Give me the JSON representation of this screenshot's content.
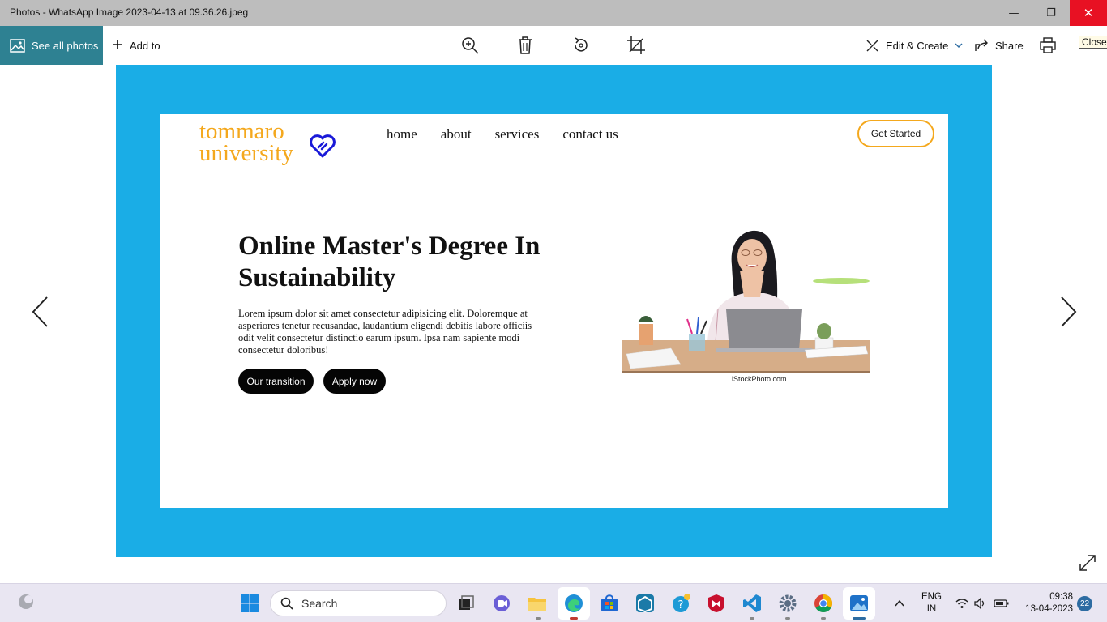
{
  "window": {
    "title": "Photos - WhatsApp Image 2023-04-13 at 09.36.26.jpeg",
    "minimize_glyph": "—",
    "maximize_glyph": "❐",
    "close_glyph": "✕"
  },
  "toolbar": {
    "see_all_photos": "See all photos",
    "add_to": "Add to",
    "edit_create": "Edit & Create",
    "share": "Share",
    "close_tooltip": "Close",
    "icons": [
      "zoom-in-icon",
      "delete-icon",
      "rotate-icon",
      "crop-icon",
      "print-icon"
    ]
  },
  "photo": {
    "background_color": "#1aade6",
    "site": {
      "logo_line1": "tommaro",
      "logo_line2": "university",
      "logo_color": "#f4a81d",
      "nav": [
        "home",
        "about",
        "services",
        "contact us"
      ],
      "cta": "Get Started",
      "headline": "Online Master's Degree In Sustainability",
      "body": "Lorem ipsum dolor sit amet consectetur adipisicing elit. Doloremque at asperiores tenetur recusandae, laudantium eligendi debitis labore officiis odit velit consectetur distinctio earum ipsum. Ipsa nam sapiente modi consectetur doloribus!",
      "buttons": [
        "Our transition",
        "Apply now"
      ],
      "image_watermark": "iStockPhoto.com"
    }
  },
  "taskbar": {
    "search_placeholder": "Search",
    "language_line1": "ENG",
    "language_line2": "IN",
    "time": "09:38",
    "date": "13-04-2023",
    "notification_count": "22"
  }
}
